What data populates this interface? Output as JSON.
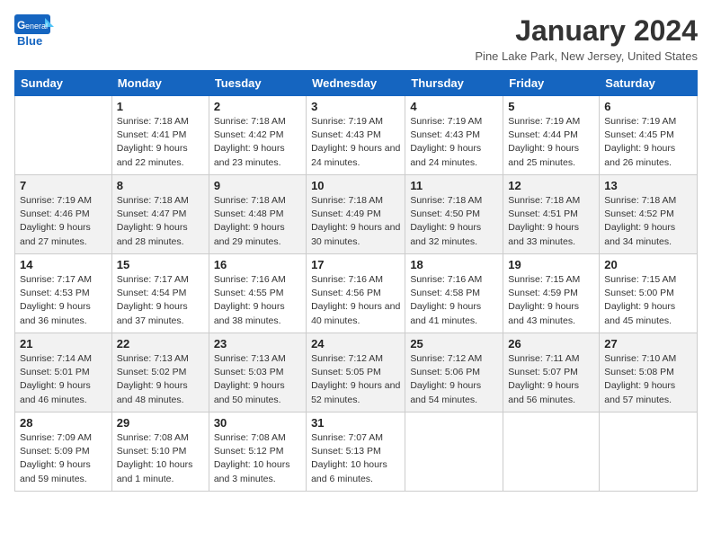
{
  "header": {
    "logo_line1": "General",
    "logo_line2": "Blue",
    "month_title": "January 2024",
    "location": "Pine Lake Park, New Jersey, United States"
  },
  "days_of_week": [
    "Sunday",
    "Monday",
    "Tuesday",
    "Wednesday",
    "Thursday",
    "Friday",
    "Saturday"
  ],
  "weeks": [
    [
      {
        "day": "",
        "sunrise": "",
        "sunset": "",
        "daylight": ""
      },
      {
        "day": "1",
        "sunrise": "Sunrise: 7:18 AM",
        "sunset": "Sunset: 4:41 PM",
        "daylight": "Daylight: 9 hours and 22 minutes."
      },
      {
        "day": "2",
        "sunrise": "Sunrise: 7:18 AM",
        "sunset": "Sunset: 4:42 PM",
        "daylight": "Daylight: 9 hours and 23 minutes."
      },
      {
        "day": "3",
        "sunrise": "Sunrise: 7:19 AM",
        "sunset": "Sunset: 4:43 PM",
        "daylight": "Daylight: 9 hours and 24 minutes."
      },
      {
        "day": "4",
        "sunrise": "Sunrise: 7:19 AM",
        "sunset": "Sunset: 4:43 PM",
        "daylight": "Daylight: 9 hours and 24 minutes."
      },
      {
        "day": "5",
        "sunrise": "Sunrise: 7:19 AM",
        "sunset": "Sunset: 4:44 PM",
        "daylight": "Daylight: 9 hours and 25 minutes."
      },
      {
        "day": "6",
        "sunrise": "Sunrise: 7:19 AM",
        "sunset": "Sunset: 4:45 PM",
        "daylight": "Daylight: 9 hours and 26 minutes."
      }
    ],
    [
      {
        "day": "7",
        "sunrise": "Sunrise: 7:19 AM",
        "sunset": "Sunset: 4:46 PM",
        "daylight": "Daylight: 9 hours and 27 minutes."
      },
      {
        "day": "8",
        "sunrise": "Sunrise: 7:18 AM",
        "sunset": "Sunset: 4:47 PM",
        "daylight": "Daylight: 9 hours and 28 minutes."
      },
      {
        "day": "9",
        "sunrise": "Sunrise: 7:18 AM",
        "sunset": "Sunset: 4:48 PM",
        "daylight": "Daylight: 9 hours and 29 minutes."
      },
      {
        "day": "10",
        "sunrise": "Sunrise: 7:18 AM",
        "sunset": "Sunset: 4:49 PM",
        "daylight": "Daylight: 9 hours and 30 minutes."
      },
      {
        "day": "11",
        "sunrise": "Sunrise: 7:18 AM",
        "sunset": "Sunset: 4:50 PM",
        "daylight": "Daylight: 9 hours and 32 minutes."
      },
      {
        "day": "12",
        "sunrise": "Sunrise: 7:18 AM",
        "sunset": "Sunset: 4:51 PM",
        "daylight": "Daylight: 9 hours and 33 minutes."
      },
      {
        "day": "13",
        "sunrise": "Sunrise: 7:18 AM",
        "sunset": "Sunset: 4:52 PM",
        "daylight": "Daylight: 9 hours and 34 minutes."
      }
    ],
    [
      {
        "day": "14",
        "sunrise": "Sunrise: 7:17 AM",
        "sunset": "Sunset: 4:53 PM",
        "daylight": "Daylight: 9 hours and 36 minutes."
      },
      {
        "day": "15",
        "sunrise": "Sunrise: 7:17 AM",
        "sunset": "Sunset: 4:54 PM",
        "daylight": "Daylight: 9 hours and 37 minutes."
      },
      {
        "day": "16",
        "sunrise": "Sunrise: 7:16 AM",
        "sunset": "Sunset: 4:55 PM",
        "daylight": "Daylight: 9 hours and 38 minutes."
      },
      {
        "day": "17",
        "sunrise": "Sunrise: 7:16 AM",
        "sunset": "Sunset: 4:56 PM",
        "daylight": "Daylight: 9 hours and 40 minutes."
      },
      {
        "day": "18",
        "sunrise": "Sunrise: 7:16 AM",
        "sunset": "Sunset: 4:58 PM",
        "daylight": "Daylight: 9 hours and 41 minutes."
      },
      {
        "day": "19",
        "sunrise": "Sunrise: 7:15 AM",
        "sunset": "Sunset: 4:59 PM",
        "daylight": "Daylight: 9 hours and 43 minutes."
      },
      {
        "day": "20",
        "sunrise": "Sunrise: 7:15 AM",
        "sunset": "Sunset: 5:00 PM",
        "daylight": "Daylight: 9 hours and 45 minutes."
      }
    ],
    [
      {
        "day": "21",
        "sunrise": "Sunrise: 7:14 AM",
        "sunset": "Sunset: 5:01 PM",
        "daylight": "Daylight: 9 hours and 46 minutes."
      },
      {
        "day": "22",
        "sunrise": "Sunrise: 7:13 AM",
        "sunset": "Sunset: 5:02 PM",
        "daylight": "Daylight: 9 hours and 48 minutes."
      },
      {
        "day": "23",
        "sunrise": "Sunrise: 7:13 AM",
        "sunset": "Sunset: 5:03 PM",
        "daylight": "Daylight: 9 hours and 50 minutes."
      },
      {
        "day": "24",
        "sunrise": "Sunrise: 7:12 AM",
        "sunset": "Sunset: 5:05 PM",
        "daylight": "Daylight: 9 hours and 52 minutes."
      },
      {
        "day": "25",
        "sunrise": "Sunrise: 7:12 AM",
        "sunset": "Sunset: 5:06 PM",
        "daylight": "Daylight: 9 hours and 54 minutes."
      },
      {
        "day": "26",
        "sunrise": "Sunrise: 7:11 AM",
        "sunset": "Sunset: 5:07 PM",
        "daylight": "Daylight: 9 hours and 56 minutes."
      },
      {
        "day": "27",
        "sunrise": "Sunrise: 7:10 AM",
        "sunset": "Sunset: 5:08 PM",
        "daylight": "Daylight: 9 hours and 57 minutes."
      }
    ],
    [
      {
        "day": "28",
        "sunrise": "Sunrise: 7:09 AM",
        "sunset": "Sunset: 5:09 PM",
        "daylight": "Daylight: 9 hours and 59 minutes."
      },
      {
        "day": "29",
        "sunrise": "Sunrise: 7:08 AM",
        "sunset": "Sunset: 5:10 PM",
        "daylight": "Daylight: 10 hours and 1 minute."
      },
      {
        "day": "30",
        "sunrise": "Sunrise: 7:08 AM",
        "sunset": "Sunset: 5:12 PM",
        "daylight": "Daylight: 10 hours and 3 minutes."
      },
      {
        "day": "31",
        "sunrise": "Sunrise: 7:07 AM",
        "sunset": "Sunset: 5:13 PM",
        "daylight": "Daylight: 10 hours and 6 minutes."
      },
      {
        "day": "",
        "sunrise": "",
        "sunset": "",
        "daylight": ""
      },
      {
        "day": "",
        "sunrise": "",
        "sunset": "",
        "daylight": ""
      },
      {
        "day": "",
        "sunrise": "",
        "sunset": "",
        "daylight": ""
      }
    ]
  ]
}
